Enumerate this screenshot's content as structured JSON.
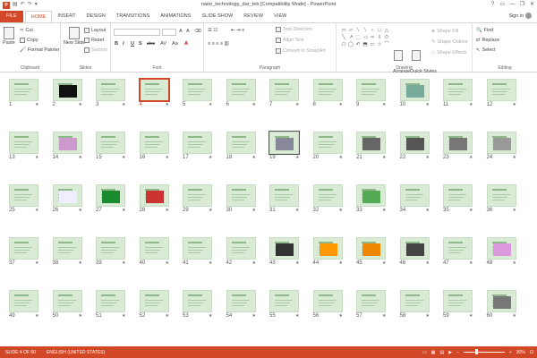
{
  "window": {
    "title": "nano_technology_dar_teb [Compatibility Mode] - PowerPoint",
    "controls": [
      "?",
      "▭",
      "—",
      "❐",
      "✕"
    ]
  },
  "qat": [
    "↶",
    "↷",
    "▤",
    "▾"
  ],
  "tabs": [
    "FILE",
    "HOME",
    "INSERT",
    "DESIGN",
    "TRANSITIONS",
    "ANIMATIONS",
    "SLIDE SHOW",
    "REVIEW",
    "VIEW"
  ],
  "active_tab": "HOME",
  "account": {
    "label": "Sign in"
  },
  "ribbon": {
    "clipboard": {
      "label": "Clipboard",
      "paste": "Paste",
      "cut": "Cut",
      "copy": "Copy",
      "format_painter": "Format Painter"
    },
    "slides": {
      "label": "Slides",
      "new_slide": "New Slide",
      "layout": "Layout",
      "reset": "Reset",
      "section": "Section"
    },
    "font": {
      "label": "Font",
      "bold": "B",
      "italic": "I",
      "underline": "U",
      "shadow": "S",
      "strike": "abc",
      "spacing": "AV",
      "case": "Aa",
      "color": "A"
    },
    "paragraph": {
      "label": "Paragraph",
      "text_direction": "Text Direction",
      "align_text": "Align Text",
      "convert_smartart": "Convert to SmartArt"
    },
    "drawing": {
      "label": "Drawing",
      "arrange": "Arrange",
      "quick_styles": "Quick Styles",
      "shape_fill": "Shape Fill",
      "shape_outline": "Shape Outline",
      "shape_effects": "Shape Effects"
    },
    "editing": {
      "label": "Editing",
      "find": "Find",
      "replace": "Replace",
      "select": "Select"
    },
    "shapes": [
      "▭",
      "▱",
      "\\",
      "\\",
      "○",
      "□",
      "△",
      "╲",
      "↗",
      "⬚",
      "◁",
      "⇨",
      "⇩",
      "⬭",
      "⬠",
      "◯",
      "↶",
      "⬒",
      "▭",
      "☆",
      "⌒"
    ]
  },
  "slides": {
    "count": 60,
    "current": 4,
    "labels": [
      "1",
      "2",
      "3",
      "4",
      "5",
      "6",
      "7",
      "8",
      "9",
      "10",
      "11",
      "12",
      "13",
      "14",
      "15",
      "16",
      "17",
      "18",
      "19",
      "20",
      "21",
      "22",
      "23",
      "24",
      "25",
      "26",
      "27",
      "28",
      "29",
      "30",
      "31",
      "32",
      "33",
      "34",
      "35",
      "36",
      "37",
      "38",
      "39",
      "40",
      "41",
      "42",
      "43",
      "44",
      "45",
      "46",
      "47",
      "48",
      "49",
      "50",
      "51",
      "52",
      "53",
      "54",
      "55",
      "56",
      "57",
      "58",
      "59",
      "60"
    ]
  },
  "status": {
    "slide_info": "SLIDE 4 OF 60",
    "language": "ENGLISH (UNITED STATES)",
    "zoom": "30%"
  },
  "colors": {
    "accent": "#d24726",
    "slide_bg": "#d9ebd4"
  }
}
